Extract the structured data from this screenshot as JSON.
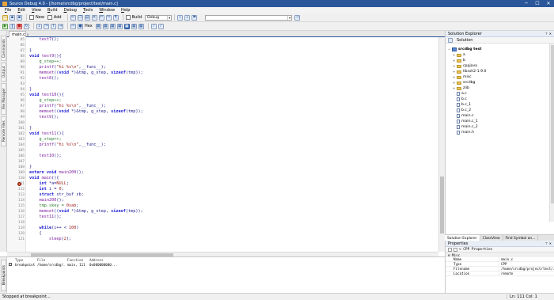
{
  "window": {
    "title": "Source Debug 4.0 - [/home/srcdbg/project/test/main.c]",
    "minimize": "─",
    "maximize": "☐",
    "close": "✕"
  },
  "menu": [
    "File",
    "Edit",
    "View",
    "Build",
    "Debug",
    "Tools",
    "Window",
    "Help"
  ],
  "toolbar": {
    "new_label": "New",
    "add_label": "Add",
    "build_label": "Build",
    "config_value": "Debug",
    "search_value": "",
    "hex_label": "Hex"
  },
  "editor": {
    "tab_label": "main.c",
    "tab_close": "x",
    "lines": [
      {
        "n": "85",
        "html": "    <span class='fn'>test7</span><span class='plain'>();</span>"
      },
      {
        "n": "86",
        "html": ""
      },
      {
        "n": "87",
        "html": "<span class='plain'>}</span>"
      },
      {
        "n": "88",
        "html": "<span class='kw'>void</span> <span class='fn'>test9</span><span class='plain'>(){</span>"
      },
      {
        "n": "89",
        "html": "    <span class='id'>g_step++;</span>"
      },
      {
        "n": "90",
        "html": "    <span class='fn'>printf</span><span class='plain'>(</span><span class='str'>\"hi %s\\n\"</span><span class='plain'>,__func__);</span>"
      },
      {
        "n": "91",
        "html": "    <span class='fn'>memset</span><span class='plain'>((</span><span class='kw'>void</span> <span class='plain'>*)&amp;tmp, g_step, </span><span class='kw'>sizeof</span><span class='plain'>(tmp));</span>"
      },
      {
        "n": "92",
        "html": "    <span class='fn'>test8</span><span class='plain'>();</span>"
      },
      {
        "n": "93",
        "html": ""
      },
      {
        "n": "94",
        "html": "<span class='plain'>}</span>"
      },
      {
        "n": "95",
        "html": "<span class='kw'>void</span> <span class='fn'>test10</span><span class='plain'>(){</span>"
      },
      {
        "n": "96",
        "html": "    <span class='id'>g_step++;</span>"
      },
      {
        "n": "97",
        "html": "    <span class='fn'>printf</span><span class='plain'>(</span><span class='str'>\"hi %s\\n\"</span><span class='plain'>,__func__);</span>"
      },
      {
        "n": "98",
        "html": "    <span class='fn'>memset</span><span class='plain'>((</span><span class='kw'>void</span> <span class='plain'>*)&amp;tmp, g_step, </span><span class='kw'>sizeof</span><span class='plain'>(tmp));</span>"
      },
      {
        "n": "99",
        "html": "    <span class='fn'>test9</span><span class='plain'>();</span>"
      },
      {
        "n": "100",
        "html": ""
      },
      {
        "n": "101",
        "html": "<span class='plain'>}</span>"
      },
      {
        "n": "102",
        "html": "<span class='kw'>void</span> <span class='fn'>test11</span><span class='plain'>(){</span>"
      },
      {
        "n": "103",
        "html": "    <span class='id'>g_step++;</span>"
      },
      {
        "n": "104",
        "html": "    <span class='fn'>printf</span><span class='plain'>(</span><span class='str'>\"hi %s\\n\"</span><span class='plain'>,__func__);</span>"
      },
      {
        "n": "105",
        "html": ""
      },
      {
        "n": "106",
        "html": "    <span class='fn'>test10</span><span class='plain'>();</span>"
      },
      {
        "n": "107",
        "html": ""
      },
      {
        "n": "108",
        "html": "<span class='plain'>}</span>"
      },
      {
        "n": "109",
        "html": "<span class='kw'>extern void</span> <span class='fn'>main200</span><span class='plain'>();</span>"
      },
      {
        "n": "110",
        "html": "<span class='kw'>void</span> <span class='fn'>main</span><span class='plain'>(){</span>"
      },
      {
        "n": "111",
        "html": "    <span class='kw'>int</span> <span class='plain'>*a=</span><span class='num'>NULL</span><span class='plain'>;</span>",
        "bp": true
      },
      {
        "n": "112",
        "html": "    <span class='kw'>int</span> <span class='plain'>i = </span><span class='num'>0</span><span class='plain'>;</span>"
      },
      {
        "n": "113",
        "html": "    <span class='kw'>struct</span> <span class='plain'>str_buf sb;</span>"
      },
      {
        "n": "114",
        "html": "    <span class='fn'>main200</span><span class='plain'>();</span>"
      },
      {
        "n": "115",
        "html": "    <span class='id'>tmp.skey = </span><span class='num'>0xab</span><span class='plain'>;</span>"
      },
      {
        "n": "116",
        "html": "    <span class='fn'>memset</span><span class='plain'>((</span><span class='kw'>void</span> <span class='plain'>*)&amp;tmp, g_step, </span><span class='kw'>sizeof</span><span class='plain'>(tmp));</span>"
      },
      {
        "n": "117",
        "html": "    <span class='fn'>test11</span><span class='plain'>();</span>"
      },
      {
        "n": "118",
        "html": ""
      },
      {
        "n": "119",
        "html": "    <span class='kw'>while</span><span class='plain'>(i++ &lt; </span><span class='num'>100</span><span class='plain'>)</span>"
      },
      {
        "n": "120",
        "html": "    <span class='plain'>{</span>"
      },
      {
        "n": "121",
        "html": "        <span class='fn'>sleep</span><span class='plain'>(</span><span class='num'>2</span><span class='plain'>);</span>"
      }
    ]
  },
  "left_tabs": [
    "Commands",
    "Output",
    "File Manager",
    "Remote Files"
  ],
  "solution_explorer": {
    "title": "Solution Explorer",
    "pin": "⊤ ✕",
    "toolbar_label": "Solution",
    "items": [
      {
        "label": "srcdbg test",
        "kind": "project",
        "depth": 0,
        "exp": "−"
      },
      {
        "label": "a",
        "kind": "folder",
        "depth": 1,
        "exp": "+"
      },
      {
        "label": "b",
        "kind": "folder",
        "depth": 1,
        "exp": "+"
      },
      {
        "label": "cppjava",
        "kind": "folder",
        "depth": 1,
        "exp": "+"
      },
      {
        "label": "libssh2-1.9.0",
        "kind": "folder",
        "depth": 1,
        "exp": "+"
      },
      {
        "label": "misc",
        "kind": "folder",
        "depth": 1,
        "exp": "+"
      },
      {
        "label": "srcdbg",
        "kind": "folder",
        "depth": 1,
        "exp": "+"
      },
      {
        "label": "zlib",
        "kind": "folder",
        "depth": 1,
        "exp": "+"
      },
      {
        "label": "a.c",
        "kind": "file",
        "depth": 1,
        "exp": ""
      },
      {
        "label": "b.c",
        "kind": "file",
        "depth": 1,
        "exp": ""
      },
      {
        "label": "b.c_1",
        "kind": "file",
        "depth": 1,
        "exp": ""
      },
      {
        "label": "b.c_2",
        "kind": "file",
        "depth": 1,
        "exp": ""
      },
      {
        "label": "main.c",
        "kind": "file",
        "depth": 1,
        "exp": ""
      },
      {
        "label": "main.c_1",
        "kind": "file",
        "depth": 1,
        "exp": ""
      },
      {
        "label": "main.c_2",
        "kind": "file",
        "depth": 1,
        "exp": ""
      },
      {
        "label": "main.h",
        "kind": "file",
        "depth": 1,
        "exp": ""
      }
    ],
    "bottom_tabs": [
      "Solution Explorer",
      "ClassView",
      "Find Symbol an..."
    ]
  },
  "properties": {
    "title": "Properties",
    "pin": "⊤ ✕",
    "toolbar_text": "< CPP Properties",
    "category": "⊟ Misc",
    "rows": [
      {
        "k": "Name",
        "v": "main.c"
      },
      {
        "k": "Type",
        "v": "CPP"
      },
      {
        "k": "Filename",
        "v": "/home/srcdbg/project/test/..."
      },
      {
        "k": "Location",
        "v": "remote"
      }
    ]
  },
  "breakpoints": {
    "tab_label": "Breakpoints",
    "headers": [
      "",
      "Type",
      "File",
      "Function",
      "Address"
    ],
    "rows": [
      {
        "checked": "✓",
        "type": "breakpoint",
        "file": "/home/srcdbg/...",
        "function": "main, 111",
        "address": "0x000000000..."
      }
    ]
  },
  "status": {
    "left": "Stopped at breakpoint...",
    "right": "Ln: 111 Col: 1"
  },
  "colors": {
    "title_bar": "#2b579a",
    "keyword": "#1b1bd6",
    "function": "#7d1d9e",
    "string": "#9a1a1a",
    "breakpoint": "#c0392b"
  }
}
